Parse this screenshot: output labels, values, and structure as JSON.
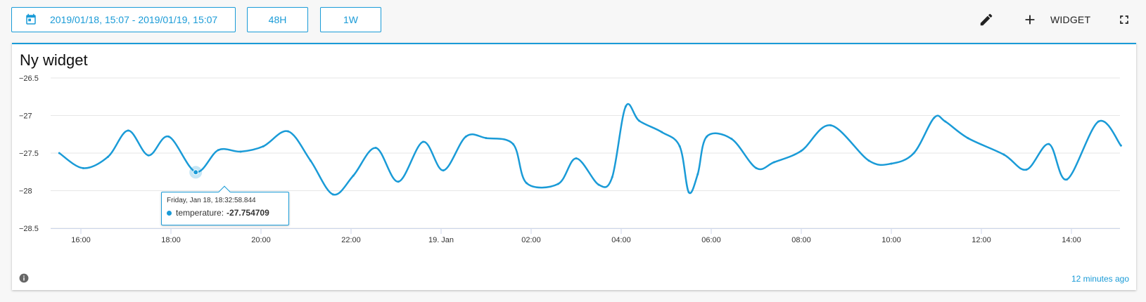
{
  "toolbar": {
    "date_range": "2019/01/18, 15:07 - 2019/01/19, 15:07",
    "btn_48h": "48H",
    "btn_1w": "1W",
    "widget_label": "WIDGET"
  },
  "widget": {
    "title": "Ny widget",
    "updated": "12 minutes ago"
  },
  "tooltip": {
    "date": "Friday, Jan 18, 18:32:58.844",
    "series": "temperature:",
    "value": "-27.754709"
  },
  "colors": {
    "accent": "#1a9bd7",
    "grid": "#e6e6e6"
  },
  "chart_data": {
    "type": "line",
    "ylim": [
      -28.5,
      -26.5
    ],
    "yticks": [
      -26.5,
      -27,
      -27.5,
      -28,
      -28.5
    ],
    "ytick_labels": [
      "−26.5",
      "−27",
      "−27.5",
      "−28",
      "−28.5"
    ],
    "xlim": [
      15.5,
      15.12
    ],
    "xticks": [
      16,
      18,
      20,
      22,
      24,
      26,
      28,
      30,
      32,
      34,
      36,
      38
    ],
    "xtick_labels": [
      "16:00",
      "18:00",
      "20:00",
      "22:00",
      "19. Jan",
      "02:00",
      "04:00",
      "06:00",
      "08:00",
      "10:00",
      "12:00",
      "14:00"
    ],
    "highlight": {
      "x": 18.55,
      "y": -27.754709
    },
    "series": [
      {
        "name": "temperature",
        "x": [
          15.52,
          16.05,
          16.6,
          17.05,
          17.5,
          17.95,
          18.55,
          19.05,
          19.55,
          20.05,
          20.6,
          21.1,
          21.6,
          22.05,
          22.55,
          23.05,
          23.6,
          24.05,
          24.55,
          25.0,
          25.6,
          25.9,
          26.6,
          27.0,
          27.5,
          27.8,
          28.1,
          28.4,
          28.9,
          29.3,
          29.5,
          29.7,
          29.9,
          30.45,
          31.0,
          31.4,
          32.0,
          32.65,
          33.5,
          34.0,
          34.5,
          34.95,
          35.2,
          35.7,
          36.5,
          37.0,
          37.5,
          37.9,
          38.6,
          39.1
        ],
        "y": [
          -27.5,
          -27.7,
          -27.55,
          -27.2,
          -27.53,
          -27.28,
          -27.75,
          -27.46,
          -27.48,
          -27.41,
          -27.21,
          -27.6,
          -28.05,
          -27.8,
          -27.43,
          -27.88,
          -27.35,
          -27.73,
          -27.28,
          -27.3,
          -27.38,
          -27.9,
          -27.91,
          -27.57,
          -27.92,
          -27.82,
          -26.88,
          -27.07,
          -27.22,
          -27.41,
          -28.02,
          -27.78,
          -27.28,
          -27.31,
          -27.7,
          -27.62,
          -27.47,
          -27.13,
          -27.6,
          -27.64,
          -27.5,
          -27.03,
          -27.08,
          -27.3,
          -27.52,
          -27.72,
          -27.38,
          -27.85,
          -27.08,
          -27.4
        ]
      }
    ]
  }
}
